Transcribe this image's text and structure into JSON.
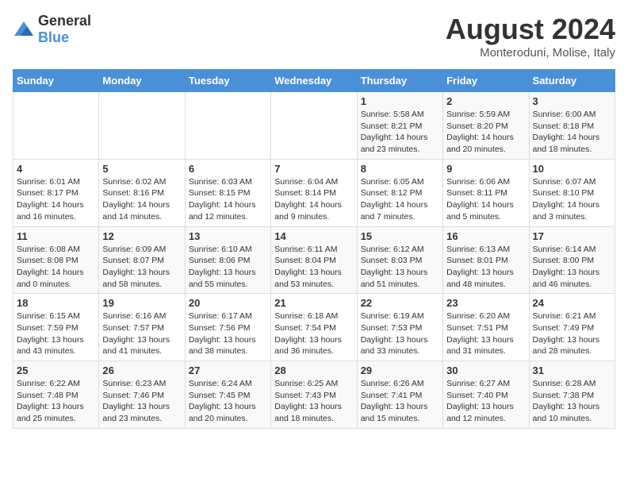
{
  "logo": {
    "general": "General",
    "blue": "Blue"
  },
  "title": "August 2024",
  "subtitle": "Monteroduni, Molise, Italy",
  "days_of_week": [
    "Sunday",
    "Monday",
    "Tuesday",
    "Wednesday",
    "Thursday",
    "Friday",
    "Saturday"
  ],
  "weeks": [
    [
      {
        "day": "",
        "info": ""
      },
      {
        "day": "",
        "info": ""
      },
      {
        "day": "",
        "info": ""
      },
      {
        "day": "",
        "info": ""
      },
      {
        "day": "1",
        "info": "Sunrise: 5:58 AM\nSunset: 8:21 PM\nDaylight: 14 hours and 23 minutes."
      },
      {
        "day": "2",
        "info": "Sunrise: 5:59 AM\nSunset: 8:20 PM\nDaylight: 14 hours and 20 minutes."
      },
      {
        "day": "3",
        "info": "Sunrise: 6:00 AM\nSunset: 8:18 PM\nDaylight: 14 hours and 18 minutes."
      }
    ],
    [
      {
        "day": "4",
        "info": "Sunrise: 6:01 AM\nSunset: 8:17 PM\nDaylight: 14 hours and 16 minutes."
      },
      {
        "day": "5",
        "info": "Sunrise: 6:02 AM\nSunset: 8:16 PM\nDaylight: 14 hours and 14 minutes."
      },
      {
        "day": "6",
        "info": "Sunrise: 6:03 AM\nSunset: 8:15 PM\nDaylight: 14 hours and 12 minutes."
      },
      {
        "day": "7",
        "info": "Sunrise: 6:04 AM\nSunset: 8:14 PM\nDaylight: 14 hours and 9 minutes."
      },
      {
        "day": "8",
        "info": "Sunrise: 6:05 AM\nSunset: 8:12 PM\nDaylight: 14 hours and 7 minutes."
      },
      {
        "day": "9",
        "info": "Sunrise: 6:06 AM\nSunset: 8:11 PM\nDaylight: 14 hours and 5 minutes."
      },
      {
        "day": "10",
        "info": "Sunrise: 6:07 AM\nSunset: 8:10 PM\nDaylight: 14 hours and 3 minutes."
      }
    ],
    [
      {
        "day": "11",
        "info": "Sunrise: 6:08 AM\nSunset: 8:08 PM\nDaylight: 14 hours and 0 minutes."
      },
      {
        "day": "12",
        "info": "Sunrise: 6:09 AM\nSunset: 8:07 PM\nDaylight: 13 hours and 58 minutes."
      },
      {
        "day": "13",
        "info": "Sunrise: 6:10 AM\nSunset: 8:06 PM\nDaylight: 13 hours and 55 minutes."
      },
      {
        "day": "14",
        "info": "Sunrise: 6:11 AM\nSunset: 8:04 PM\nDaylight: 13 hours and 53 minutes."
      },
      {
        "day": "15",
        "info": "Sunrise: 6:12 AM\nSunset: 8:03 PM\nDaylight: 13 hours and 51 minutes."
      },
      {
        "day": "16",
        "info": "Sunrise: 6:13 AM\nSunset: 8:01 PM\nDaylight: 13 hours and 48 minutes."
      },
      {
        "day": "17",
        "info": "Sunrise: 6:14 AM\nSunset: 8:00 PM\nDaylight: 13 hours and 46 minutes."
      }
    ],
    [
      {
        "day": "18",
        "info": "Sunrise: 6:15 AM\nSunset: 7:59 PM\nDaylight: 13 hours and 43 minutes."
      },
      {
        "day": "19",
        "info": "Sunrise: 6:16 AM\nSunset: 7:57 PM\nDaylight: 13 hours and 41 minutes."
      },
      {
        "day": "20",
        "info": "Sunrise: 6:17 AM\nSunset: 7:56 PM\nDaylight: 13 hours and 38 minutes."
      },
      {
        "day": "21",
        "info": "Sunrise: 6:18 AM\nSunset: 7:54 PM\nDaylight: 13 hours and 36 minutes."
      },
      {
        "day": "22",
        "info": "Sunrise: 6:19 AM\nSunset: 7:53 PM\nDaylight: 13 hours and 33 minutes."
      },
      {
        "day": "23",
        "info": "Sunrise: 6:20 AM\nSunset: 7:51 PM\nDaylight: 13 hours and 31 minutes."
      },
      {
        "day": "24",
        "info": "Sunrise: 6:21 AM\nSunset: 7:49 PM\nDaylight: 13 hours and 28 minutes."
      }
    ],
    [
      {
        "day": "25",
        "info": "Sunrise: 6:22 AM\nSunset: 7:48 PM\nDaylight: 13 hours and 25 minutes."
      },
      {
        "day": "26",
        "info": "Sunrise: 6:23 AM\nSunset: 7:46 PM\nDaylight: 13 hours and 23 minutes."
      },
      {
        "day": "27",
        "info": "Sunrise: 6:24 AM\nSunset: 7:45 PM\nDaylight: 13 hours and 20 minutes."
      },
      {
        "day": "28",
        "info": "Sunrise: 6:25 AM\nSunset: 7:43 PM\nDaylight: 13 hours and 18 minutes."
      },
      {
        "day": "29",
        "info": "Sunrise: 6:26 AM\nSunset: 7:41 PM\nDaylight: 13 hours and 15 minutes."
      },
      {
        "day": "30",
        "info": "Sunrise: 6:27 AM\nSunset: 7:40 PM\nDaylight: 13 hours and 12 minutes."
      },
      {
        "day": "31",
        "info": "Sunrise: 6:28 AM\nSunset: 7:38 PM\nDaylight: 13 hours and 10 minutes."
      }
    ]
  ]
}
